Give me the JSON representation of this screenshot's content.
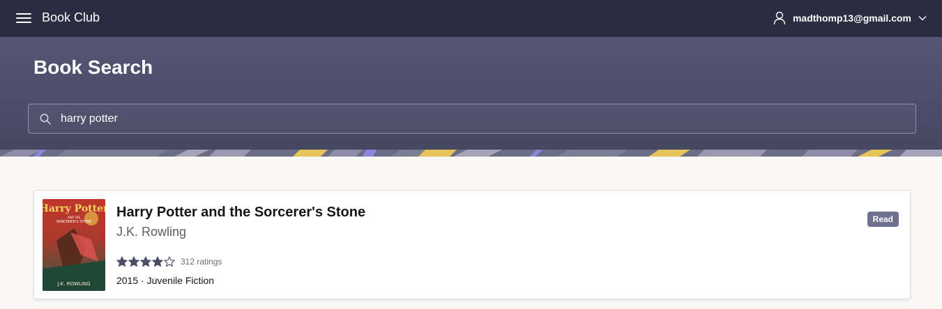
{
  "header": {
    "app_title": "Book Club",
    "user_email": "madthomp13@gmail.com",
    "icons": {
      "menu": "hamburger-icon",
      "user": "user-icon",
      "dropdown": "chevron-down-icon"
    }
  },
  "hero": {
    "title": "Book Search",
    "search": {
      "value": "harry potter",
      "icon": "search-icon"
    }
  },
  "results": [
    {
      "title": "Harry Potter and the Sorcerer's Stone",
      "author": "J.K. Rowling",
      "rating": 4,
      "rating_max": 5,
      "ratings_count": "312 ratings",
      "meta": "2015 · Juvenile Fiction",
      "status_badge": "Read",
      "cover": {
        "title_line1": "Harry Potter",
        "title_line2": "AND THE",
        "title_line3": "SORCERER'S STONE",
        "author": "J.K. ROWLING"
      }
    }
  ],
  "colors": {
    "topbar": "#2b2c41",
    "hero": "#4b4d6b",
    "badge": "#6e7190",
    "star": "#4c4e66"
  }
}
